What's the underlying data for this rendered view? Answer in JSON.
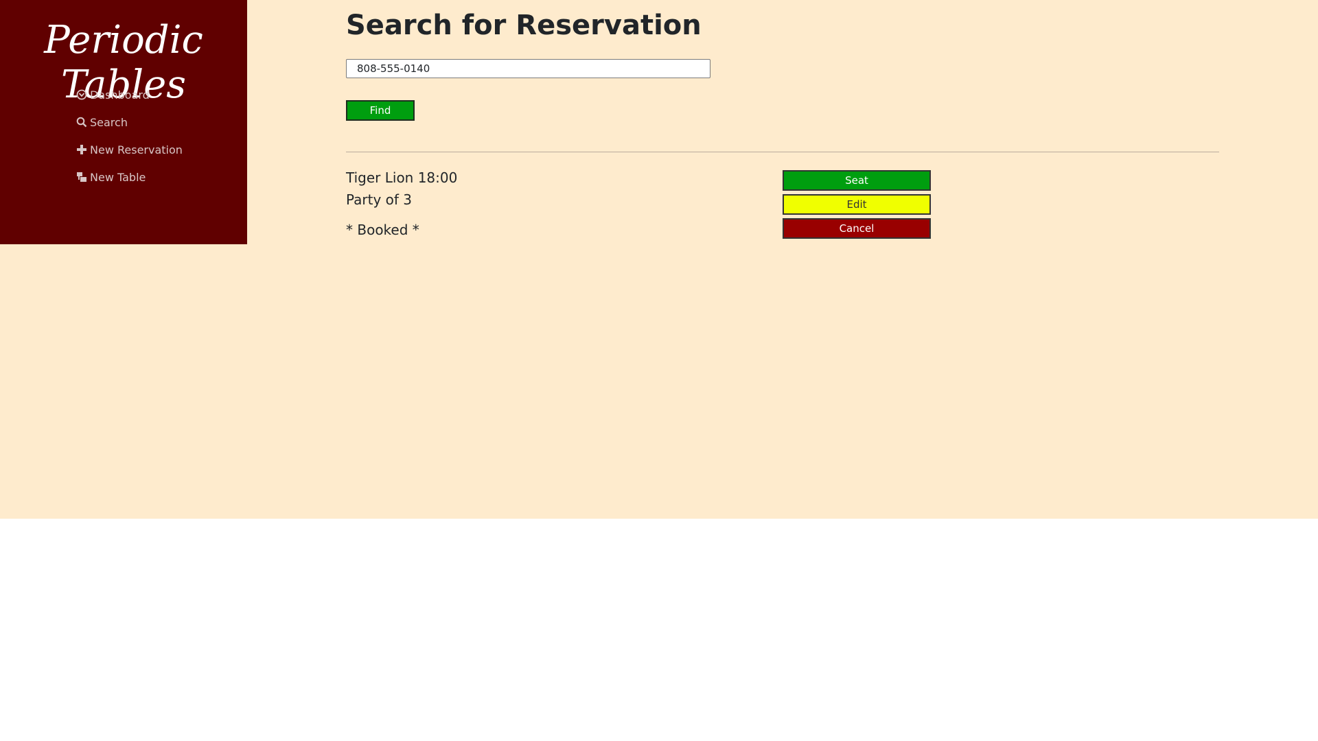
{
  "sidebar": {
    "brand": "Periodic Tables",
    "items": [
      {
        "label": "Dashboard",
        "icon": "dashboard-icon"
      },
      {
        "label": "Search",
        "icon": "search-icon"
      },
      {
        "label": "New Reservation",
        "icon": "plus-icon"
      },
      {
        "label": "New Table",
        "icon": "table-icon"
      }
    ]
  },
  "main": {
    "title": "Search for Reservation",
    "search": {
      "value": "808-555-0140"
    },
    "find_label": "Find",
    "reservation": {
      "name_time": "Tiger Lion 18:00",
      "party": "Party of 3",
      "status": "* Booked *",
      "actions": {
        "seat": "Seat",
        "edit": "Edit",
        "cancel": "Cancel"
      }
    }
  },
  "colors": {
    "background": "#feebcd",
    "sidebar": "#600000",
    "seat": "#009e0f",
    "edit": "#f0ff00",
    "cancel": "#990000"
  }
}
